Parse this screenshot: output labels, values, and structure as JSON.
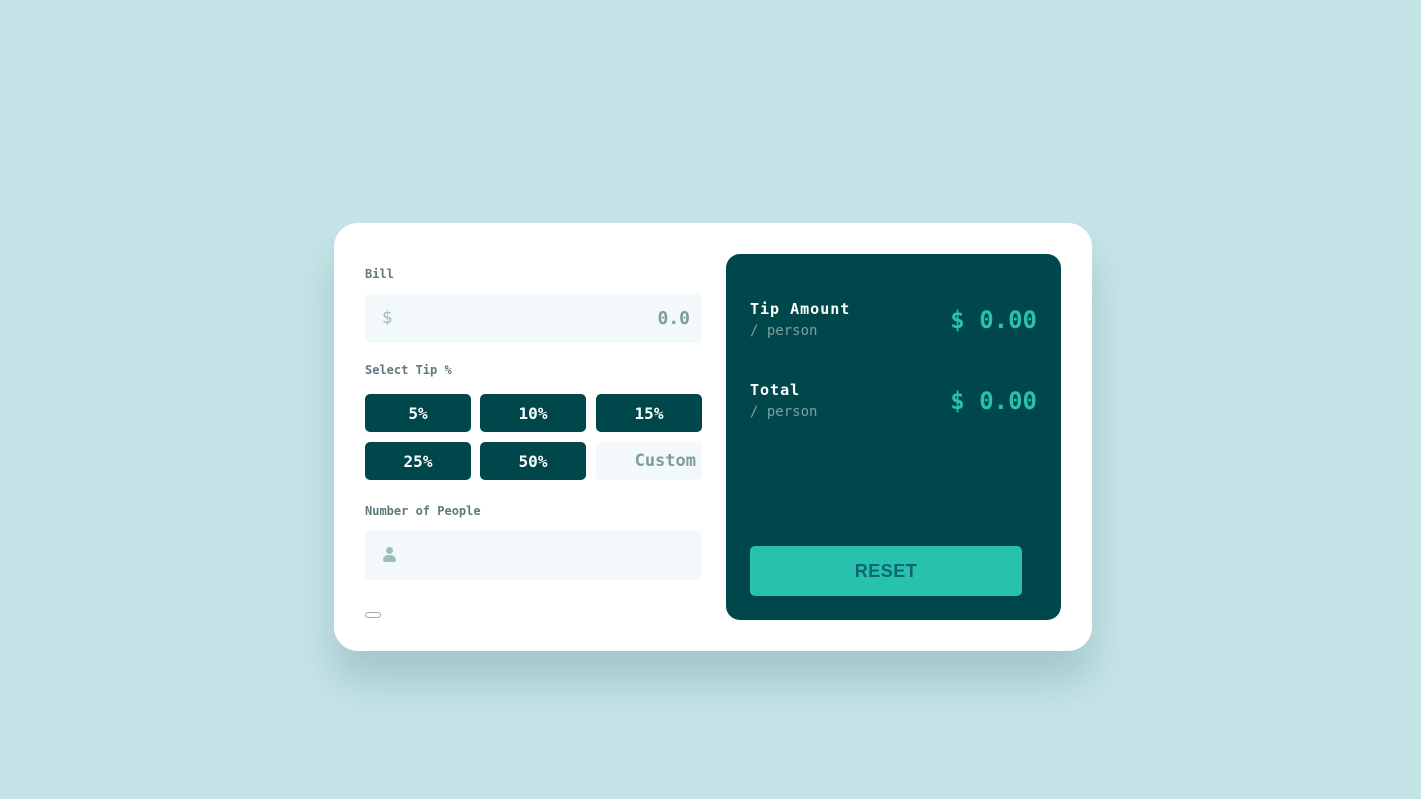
{
  "bill": {
    "label": "Bill",
    "currency_symbol": "$",
    "placeholder": "0.0",
    "value": ""
  },
  "tip": {
    "label": "Select Tip %",
    "options": [
      "5%",
      "10%",
      "15%",
      "25%",
      "50%"
    ],
    "custom_placeholder": "Custom"
  },
  "people": {
    "label": "Number of People",
    "icon": "person-icon",
    "value": ""
  },
  "results": {
    "tip_amount": {
      "title": "Tip Amount",
      "sub": "/ person",
      "value": "$ 0.00"
    },
    "total": {
      "title": "Total",
      "sub": "/ person",
      "value": "$ 0.00"
    },
    "reset_label": "RESET"
  },
  "colors": {
    "background": "#c5e4e7",
    "dark_teal": "#00474b",
    "accent": "#26c2ae",
    "input_bg": "#f3f9fa"
  }
}
